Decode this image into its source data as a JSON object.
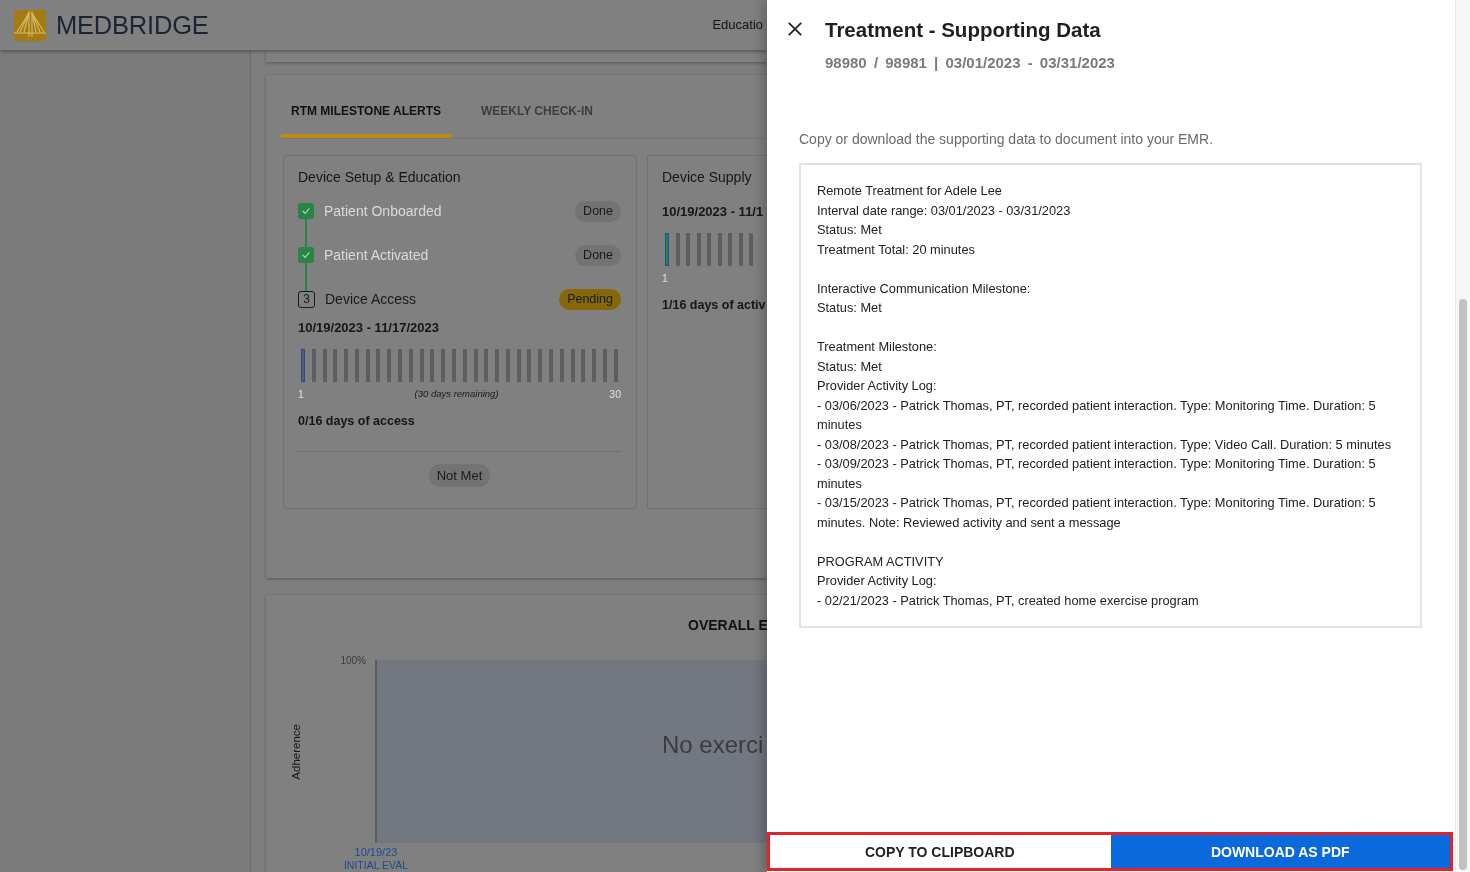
{
  "header": {
    "logo_text": "MEDBRIDGE",
    "nav_items": [
      "Educatio"
    ]
  },
  "tabs": [
    {
      "label": "RTM MILESTONE ALERTS",
      "selected": true
    },
    {
      "label": "WEEKLY CHECK-IN",
      "selected": false
    }
  ],
  "milestones": [
    {
      "title": "Device Setup & Education",
      "steps": [
        {
          "kind": "completed",
          "label": "Patient Onboarded",
          "badge": "Done"
        },
        {
          "kind": "completed",
          "label": "Patient Activated",
          "badge": "Done"
        },
        {
          "kind": "pending",
          "number": "3",
          "label": "Device Access",
          "badge": "Pending"
        }
      ],
      "date_range": "10/19/2023 - 11/17/2023",
      "days": [
        {
          "current": true,
          "active": false
        },
        {
          "current": false,
          "active": false
        },
        {
          "current": false,
          "active": false
        },
        {
          "current": false,
          "active": false
        },
        {
          "current": false,
          "active": false
        },
        {
          "current": false,
          "active": false
        },
        {
          "current": false,
          "active": false
        },
        {
          "current": false,
          "active": false
        },
        {
          "current": false,
          "active": false
        },
        {
          "current": false,
          "active": false
        },
        {
          "current": false,
          "active": false
        },
        {
          "current": false,
          "active": false
        },
        {
          "current": false,
          "active": false
        },
        {
          "current": false,
          "active": false
        },
        {
          "current": false,
          "active": false
        },
        {
          "current": false,
          "active": false
        },
        {
          "current": false,
          "active": false
        },
        {
          "current": false,
          "active": false
        },
        {
          "current": false,
          "active": false
        },
        {
          "current": false,
          "active": false
        },
        {
          "current": false,
          "active": false
        },
        {
          "current": false,
          "active": false
        },
        {
          "current": false,
          "active": false
        },
        {
          "current": false,
          "active": false
        },
        {
          "current": false,
          "active": false
        },
        {
          "current": false,
          "active": false
        },
        {
          "current": false,
          "active": false
        },
        {
          "current": false,
          "active": false
        },
        {
          "current": false,
          "active": false
        },
        {
          "current": false,
          "active": false
        }
      ],
      "start_label": "1",
      "remaining": "(30 days remaining)",
      "end_label": "30",
      "summary": "0/16 days of access",
      "result": "Not Met"
    },
    {
      "title": "Device Supply",
      "date_range": "10/19/2023 - 11/1",
      "days": [
        {
          "current": true,
          "active": true
        },
        {
          "current": false,
          "active": false
        },
        {
          "current": false,
          "active": false
        },
        {
          "current": false,
          "active": false
        },
        {
          "current": false,
          "active": false
        },
        {
          "current": false,
          "active": false
        },
        {
          "current": false,
          "active": false
        },
        {
          "current": false,
          "active": false
        },
        {
          "current": false,
          "active": false
        }
      ],
      "start_label": "1",
      "summary": "1/16 days of activ"
    }
  ],
  "chart_panel": {
    "title": "OVERALL E",
    "y_tick": "100%",
    "ylabel": "Adherence",
    "empty_message": "No exerci",
    "x_labels": [
      {
        "date": "10/19/23",
        "label": "INITIAL EVAL"
      }
    ]
  },
  "drawer": {
    "title": "Treatment - Supporting Data",
    "subtitle": "98980 / 98981 | 03/01/2023 - 03/31/2023",
    "description": "Copy or download the supporting data to document into your EMR.",
    "report_sections": [
      [
        "Remote Treatment for Adele Lee",
        "Interval date range: 03/01/2023 - 03/31/2023",
        "Status: Met",
        "Treatment Total: 20 minutes"
      ],
      [
        "Interactive Communication Milestone:",
        "Status: Met"
      ],
      [
        "Treatment Milestone:",
        "Status: Met",
        "Provider Activity Log:",
        "- 03/06/2023 - Patrick Thomas, PT, recorded patient interaction. Type: Monitoring Time. Duration: 5 minutes",
        "- 03/08/2023 - Patrick Thomas, PT, recorded patient interaction. Type: Video Call. Duration: 5 minutes",
        "- 03/09/2023 - Patrick Thomas, PT, recorded patient interaction. Type: Monitoring Time. Duration: 5 minutes",
        "- 03/15/2023 - Patrick Thomas, PT, recorded patient interaction. Type: Monitoring Time. Duration: 5 minutes. Note: Reviewed activity and sent a message"
      ],
      [
        "PROGRAM ACTIVITY",
        "Provider Activity Log:",
        "- 02/21/2023 - Patrick Thomas, PT, created home exercise program"
      ]
    ],
    "actions_highlighted": true,
    "buttons": [
      {
        "kind": "copy",
        "label": "COPY TO CLIPBOARD"
      },
      {
        "kind": "download",
        "label": "DOWNLOAD AS PDF"
      }
    ]
  }
}
